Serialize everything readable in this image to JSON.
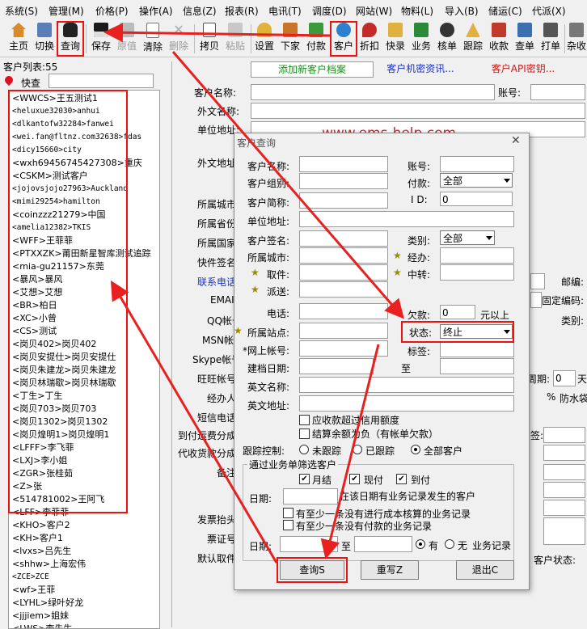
{
  "menu": [
    "系统(S)",
    "管理(M)",
    "价格(P)",
    "操作(A)",
    "信息(Z)",
    "报表(R)",
    "电讯(T)",
    "调度(D)",
    "网站(W)",
    "物料(L)",
    "导入(B)",
    "储运(C)",
    "代派(X)"
  ],
  "toolbar": {
    "items": [
      {
        "label": "主页",
        "icon": "home-icon",
        "enabled": true
      },
      {
        "label": "切换",
        "icon": "switch-icon",
        "enabled": true
      },
      {
        "label": "查询",
        "icon": "binoculars-icon",
        "enabled": true
      },
      {
        "label": "保存",
        "icon": "save-icon",
        "enabled": true
      },
      {
        "label": "原值",
        "icon": "undo-icon",
        "enabled": false
      },
      {
        "label": "清除",
        "icon": "clear-icon",
        "enabled": true
      },
      {
        "label": "删除",
        "icon": "delete-icon",
        "enabled": false
      },
      {
        "label": "拷贝",
        "icon": "copy-icon",
        "enabled": true
      },
      {
        "label": "粘贴",
        "icon": "paste-icon",
        "enabled": false
      },
      {
        "label": "设置",
        "icon": "settings-icon",
        "enabled": true
      },
      {
        "label": "下家",
        "icon": "downstream-icon",
        "enabled": true
      },
      {
        "label": "付款",
        "icon": "payment-icon",
        "enabled": true
      },
      {
        "label": "客户",
        "icon": "customers-icon",
        "enabled": true
      },
      {
        "label": "折扣",
        "icon": "discount-icon",
        "enabled": true
      },
      {
        "label": "快录",
        "icon": "quick-entry-icon",
        "enabled": true
      },
      {
        "label": "业务",
        "icon": "business-icon",
        "enabled": true
      },
      {
        "label": "核单",
        "icon": "verify-icon",
        "enabled": true
      },
      {
        "label": "跟踪",
        "icon": "track-icon",
        "enabled": true
      },
      {
        "label": "收款",
        "icon": "receive-icon",
        "enabled": true
      },
      {
        "label": "查单",
        "icon": "search-order-icon",
        "enabled": true
      },
      {
        "label": "打单",
        "icon": "print-icon",
        "enabled": true
      },
      {
        "label": "杂收",
        "icon": "misc-icon",
        "enabled": true
      }
    ]
  },
  "left": {
    "count_label": "客户列表:55",
    "quick_search_label": "快查",
    "customers": [
      "<WWCS>王五测试1",
      "<heluxue32030>anhui",
      "<dlkantofw32284>fanwei",
      "<wei.fan@fltnz.com32638>fdas",
      "<dicy15660>city",
      "<wxh69456745427308>重庆",
      "<CSKM>测试客户",
      "<jojovsjojo27963>Auckland",
      "<mimi29254>hamilton",
      "<coinzzz21279>中国",
      "<amelia12382>TKIS",
      "<WFF>王菲菲",
      "<PTXXZK>莆田新星智库测试追踪",
      "<mia-gu21157>东莞",
      "<暴风>暴风",
      "<艾想>艾想",
      "<BR>柏日",
      "<XC>小曾",
      "<CS>测试",
      "<岗贝402>岗贝402",
      "<岗贝安提仕>岗贝安提仕",
      "<岗贝朱建龙>岗贝朱建龙",
      "<岗贝林瑞歇>岗贝林瑞歇",
      "<丁生>丁生",
      "<岗贝703>岗贝703",
      "<岗贝1302>岗贝1302",
      "<岗贝煌明1>岗贝煌明1",
      "<LFFF>李飞菲",
      "<LXJ>李小姐",
      "<ZGR>张桂茹",
      "<Z>张",
      "<514781002>王阿飞",
      "<LFF>李菲菲",
      "<KHO>客户2",
      "<KH>客户1",
      "<lvxs>吕先生",
      "<shhw>上海宏伟",
      "<ZCE>ZCE",
      "<wf>王菲",
      "<LYHL>绿叶好龙",
      "<jjjiem>姐妹",
      "<LWS>李先生"
    ]
  },
  "main": {
    "tabs": [
      "添加新客户档案",
      "客户机密资讯...",
      "客户API密钥..."
    ],
    "fields_left": [
      "客户名称:",
      "外文名称:",
      "单位地址:",
      "外文地址:",
      "所属城市:",
      "所属省份:",
      "所属国家:",
      "快件签名:",
      "联系电话:",
      "EMAIL:",
      "QQ帐号:",
      "MSN帐号:",
      "Skype帐号:",
      "旺旺帐号:",
      "经办人:",
      "短信电话:",
      "到付运费分成:",
      "代收货款分成:",
      "备注:",
      "发票抬头:",
      "票证号:",
      "默认取件:"
    ],
    "fields_right": [
      "账号:",
      "邮编:",
      "固定编码:",
      "类别:",
      "周期:",
      "天",
      "%",
      "防水袋",
      "签:",
      "客户状态:"
    ],
    "zhouqi_value": "0",
    "contact_label": "联系电话"
  },
  "dialog": {
    "title": "客户查询",
    "labels": {
      "name": "客户名称:",
      "group": "客户组别:",
      "short": "客户简称:",
      "addr": "单位地址:",
      "sign": "客户签名:",
      "city": "所属城市:",
      "pickup": "取件:",
      "dispatch": "派送:",
      "phone": "电话:",
      "station": "所属站点:",
      "web": "*网上帐号:",
      "created": "建档日期:",
      "to": "至",
      "en_name": "英文名称:",
      "en_addr": "英文地址:",
      "account": "账号:",
      "pay": "付款:",
      "id": "I D:",
      "category": "类别:",
      "handler": "经办:",
      "transit": "中转:",
      "owed": "欠款:",
      "above": "元以上",
      "status": "状态:",
      "tag": "标签:"
    },
    "values": {
      "pay": "全部",
      "id": "0",
      "category": "全部",
      "owed": "0",
      "status": "终止"
    },
    "checks": {
      "credit": "应收款超过信用额度",
      "settle": "结算余额为负（有帐单欠款）"
    },
    "tracking": {
      "label": "跟踪控制:",
      "options": [
        "未跟踪",
        "已跟踪",
        "全部客户"
      ],
      "selected": 2
    },
    "filter_group": {
      "title": "通过业务单筛选客户",
      "options": [
        "月结",
        "现付",
        "到付"
      ],
      "date_label": "日期:",
      "date_text": "在该日期有业务记录发生的客户",
      "cost": "有至少一条没有进行成本核算的业务记录",
      "payment": "有至少一条没有付款的业务记录"
    },
    "bottom": {
      "date_label": "日期:",
      "to": "至",
      "has": "有",
      "none": "无",
      "record": "业务记录"
    },
    "buttons": {
      "query": "查询S",
      "rewrite": "重写Z",
      "exit": "退出C"
    }
  },
  "watermark": "www.ems-help.com",
  "colors": {
    "highlight": "#e11111",
    "link": "#1a33c8",
    "accent_green": "#119911"
  }
}
